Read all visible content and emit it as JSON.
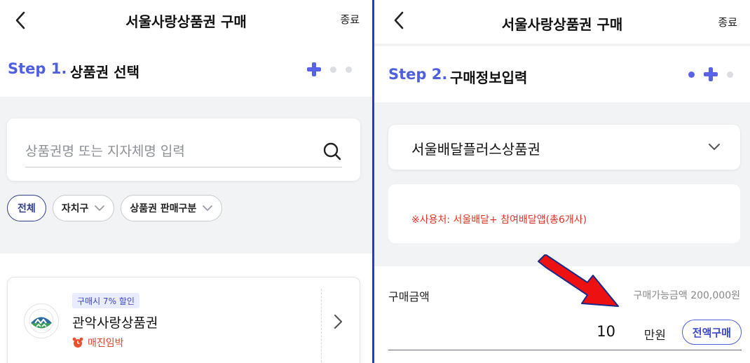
{
  "left": {
    "header": {
      "title": "서울사랑상품권 구매",
      "close_label": "종료"
    },
    "step": {
      "number": "Step 1.",
      "title": "상품권 선택"
    },
    "search": {
      "placeholder": "상품권명 또는 지자체명 입력"
    },
    "filters": [
      {
        "label": "전체",
        "selected": true
      },
      {
        "label": "자치구",
        "selected": false
      },
      {
        "label": "상품권 판매구분",
        "selected": false
      }
    ],
    "voucher": {
      "badge": "구매시 7% 할인",
      "name": "관악사랑상품권",
      "status": "매진임박"
    }
  },
  "right": {
    "header": {
      "title": "서울사랑상품권 구매",
      "close_label": "종료"
    },
    "step": {
      "number": "Step 2.",
      "title": "구매정보입력"
    },
    "selected_voucher": "서울배달플러스상품권",
    "notice": "※사용처: 서울배달+ 참여배달앱(총6개사)",
    "amount": {
      "label": "구매금액",
      "available": "구매가능금액 200,000원",
      "value": "10",
      "unit": "만원",
      "full_button": "전액구매"
    }
  },
  "colors": {
    "accent": "#5863e8",
    "step_blue": "#4e5fe0",
    "alert_red": "#e03428",
    "annotation_arrow": "#ee1111"
  },
  "icons": [
    "back-arrow-icon",
    "search-icon",
    "chevron-down-icon",
    "chevron-right-icon",
    "alarm-clock-icon",
    "plus-icon"
  ]
}
